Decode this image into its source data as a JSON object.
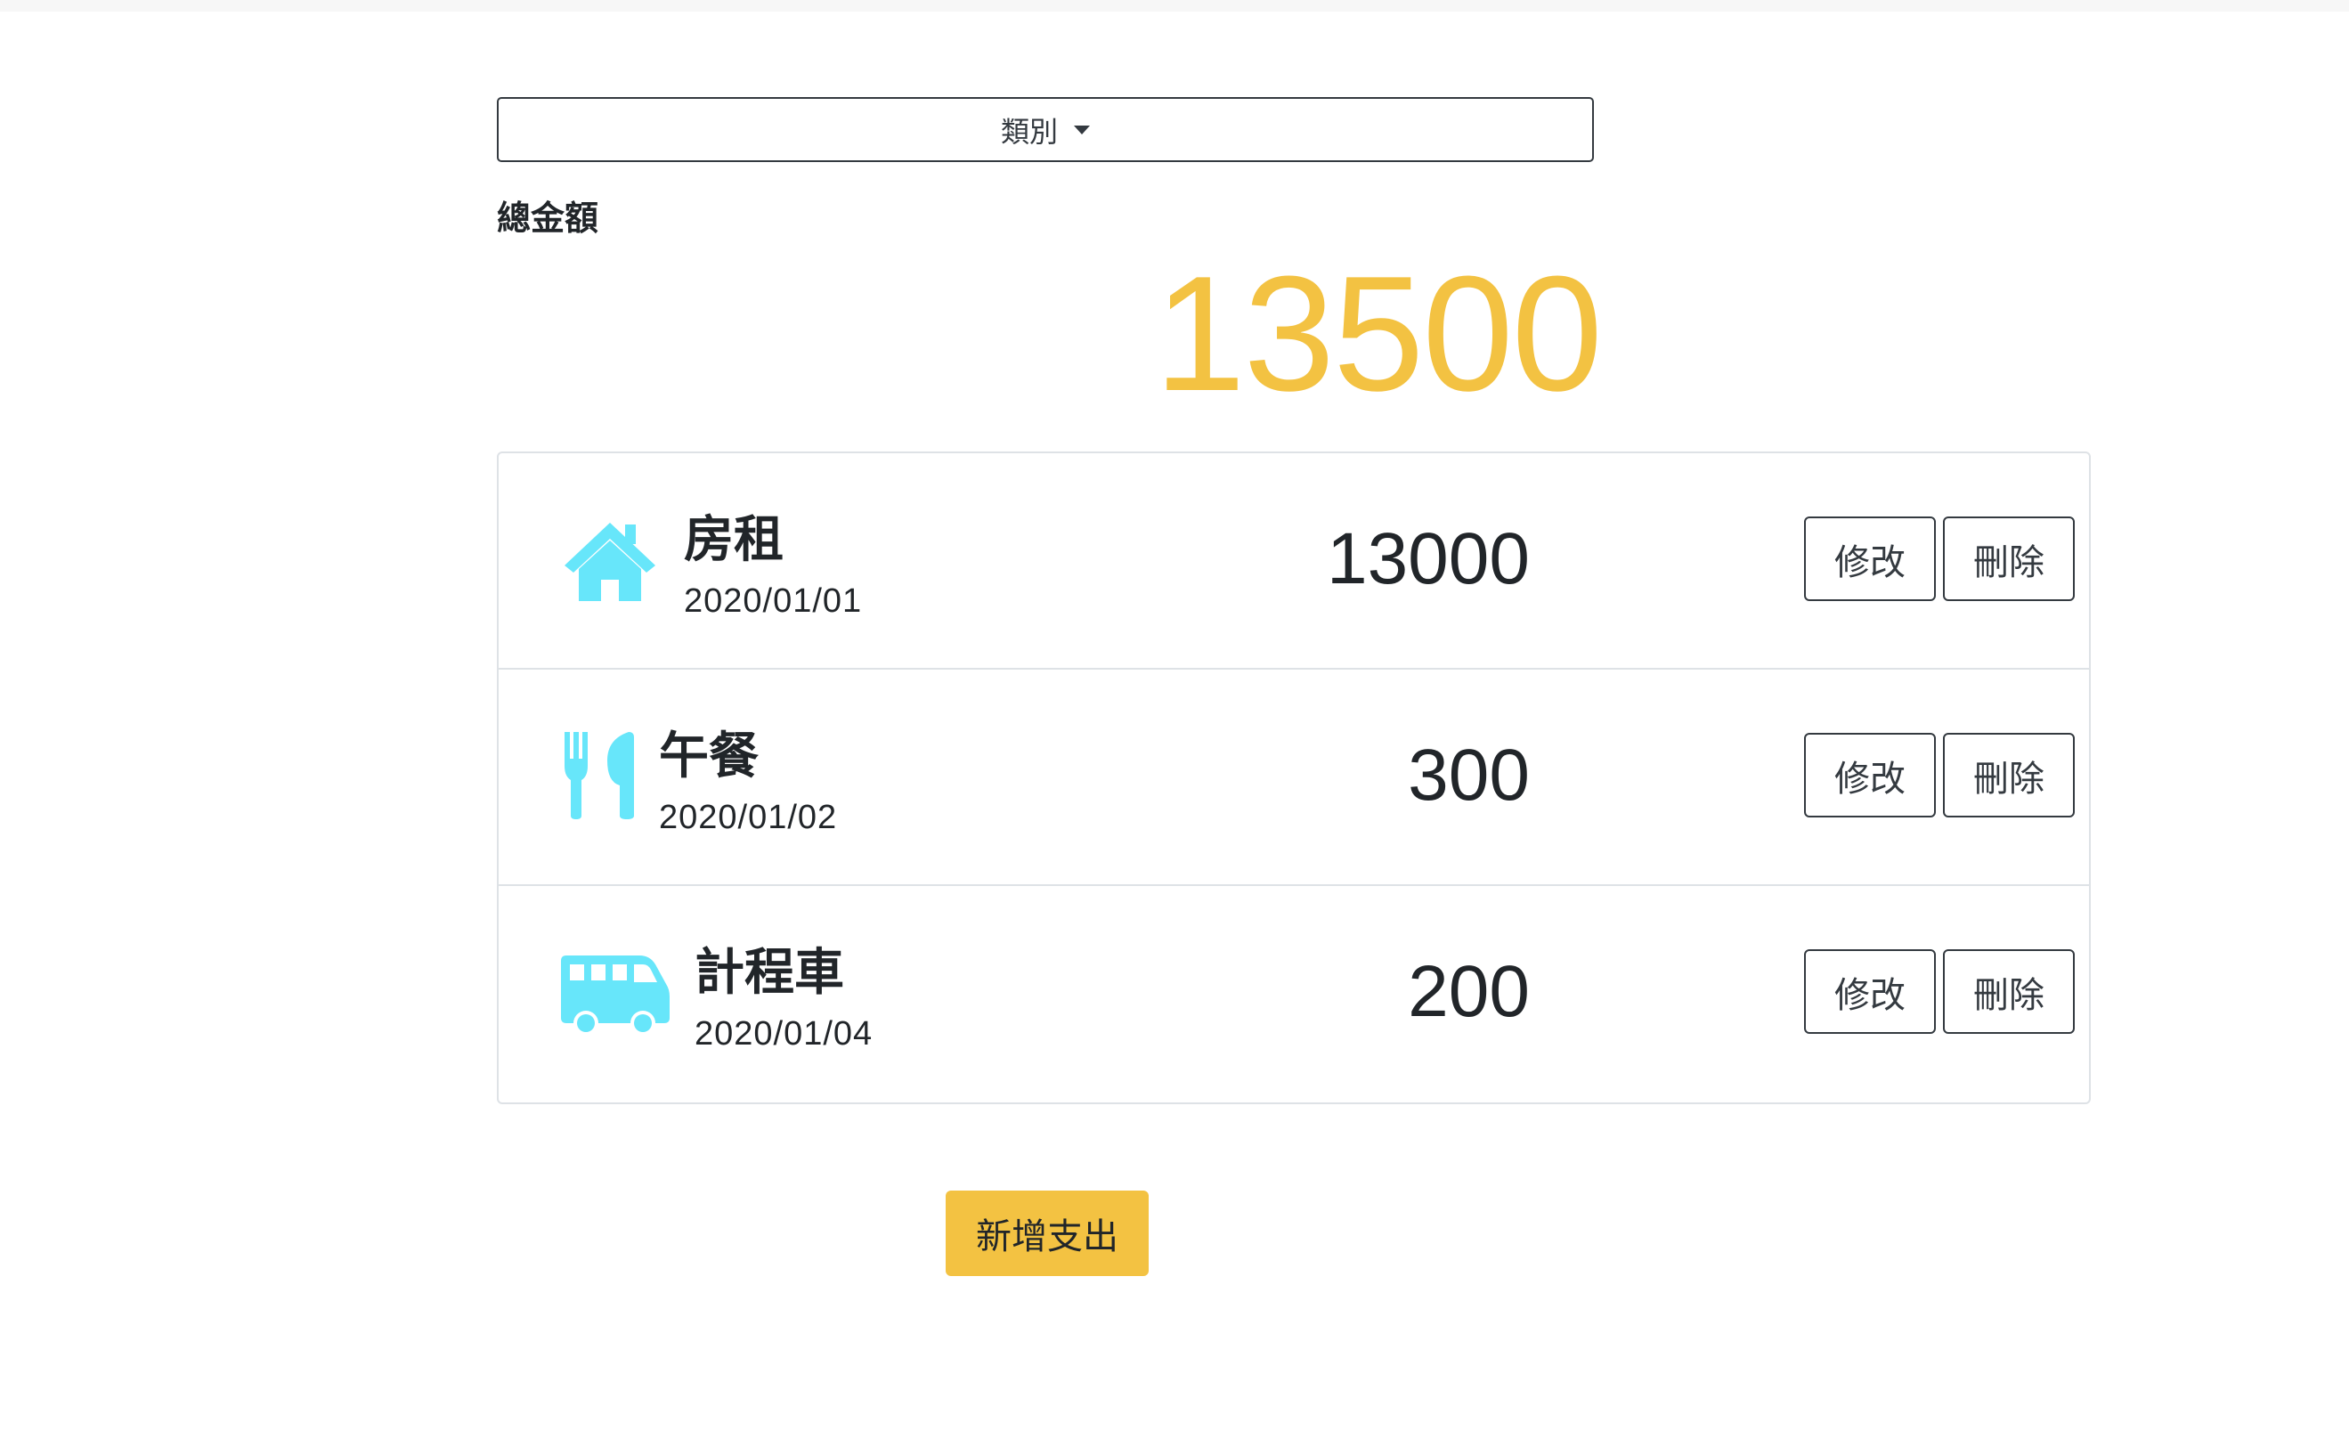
{
  "filter": {
    "category_label": "類別"
  },
  "summary": {
    "total_label": "總金額",
    "total_value": "13500"
  },
  "expenses": [
    {
      "icon": "house-icon",
      "name": "房租",
      "date": "2020/01/01",
      "amount": "13000",
      "edit_label": "修改",
      "delete_label": "刪除"
    },
    {
      "icon": "utensils-icon",
      "name": "午餐",
      "date": "2020/01/02",
      "amount": "300",
      "edit_label": "修改",
      "delete_label": "刪除"
    },
    {
      "icon": "van-icon",
      "name": "計程車",
      "date": "2020/01/04",
      "amount": "200",
      "edit_label": "修改",
      "delete_label": "刪除"
    }
  ],
  "actions": {
    "add_label": "新增支出"
  },
  "colors": {
    "accent": "#f3c242",
    "icon": "#67e6fa",
    "text": "#212529"
  }
}
